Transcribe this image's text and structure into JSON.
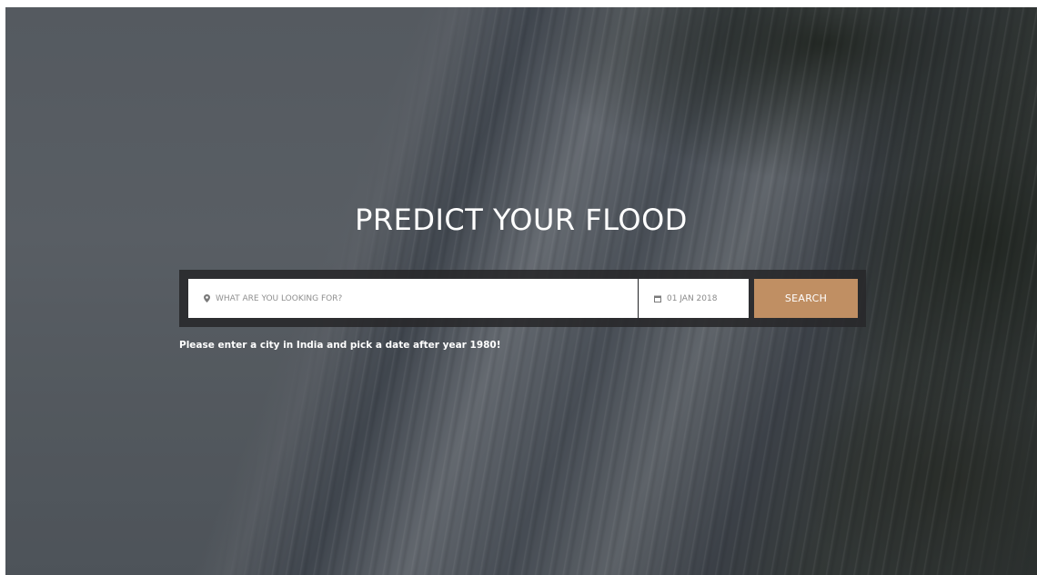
{
  "hero": {
    "title": "PREDICT YOUR FLOOD",
    "hint": "Please enter a city in India and pick a date after year 1980!"
  },
  "search": {
    "location_placeholder": "WHAT ARE YOU LOOKING FOR?",
    "location_icon": "map-pin-icon",
    "date_value": "01 JAN 2018",
    "date_icon": "calendar-icon",
    "button_label": "SEARCH",
    "button_color": "#c08f63"
  }
}
